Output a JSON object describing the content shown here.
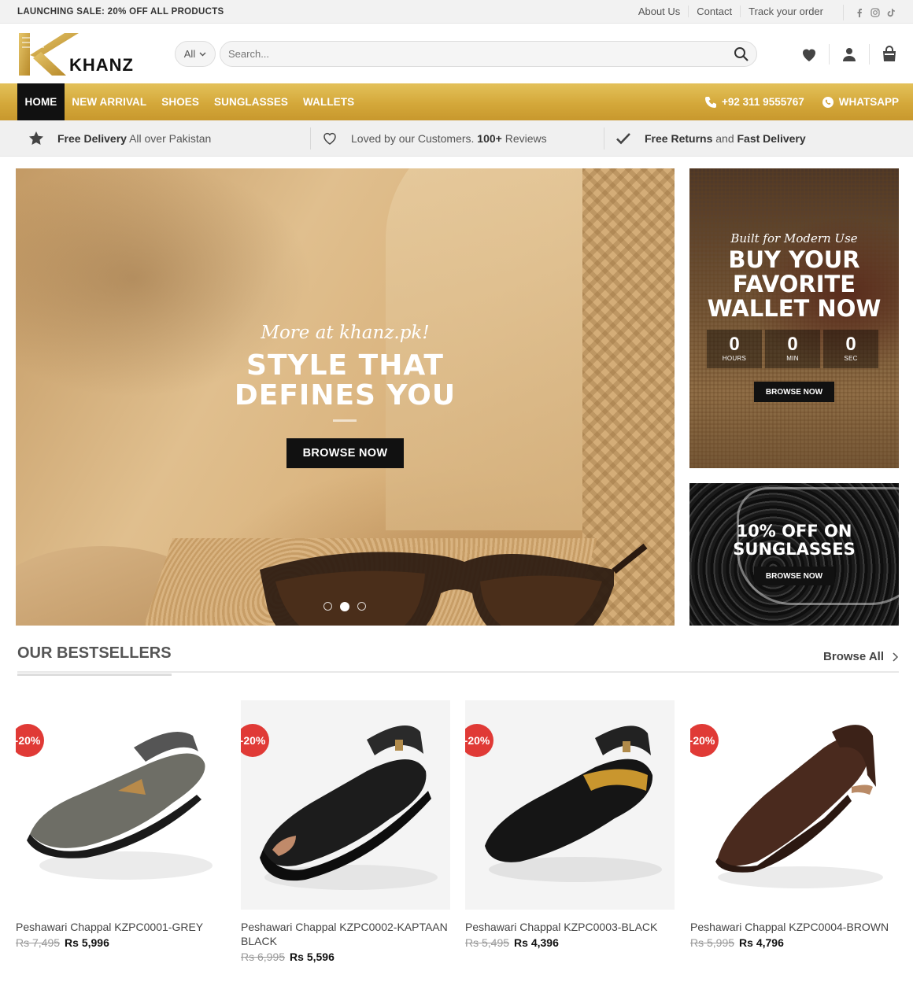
{
  "topbar": {
    "sale_text": "LAUNCHING SALE: 20% OFF ALL PRODUCTS",
    "links": [
      "About Us",
      "Contact",
      "Track your order"
    ],
    "social_icons": [
      "facebook-icon",
      "instagram-icon",
      "tiktok-icon"
    ]
  },
  "header": {
    "logo_text": "KHANZ",
    "category_select": "All",
    "search_placeholder": "Search...",
    "icons": [
      "heart-icon",
      "user-icon",
      "bag-icon"
    ]
  },
  "nav": {
    "items": [
      "HOME",
      "NEW ARRIVAL",
      "SHOES",
      "SUNGLASSES",
      "WALLETS"
    ],
    "active": "HOME",
    "phone": "+92 311 9555767",
    "whatsapp": "WHATSAPP"
  },
  "benefits": [
    {
      "bold": "Free Delivery",
      "rest": " All over Pakistan",
      "icon": "star-icon"
    },
    {
      "pre": "Loved by our Customers. ",
      "bold": "100+",
      "rest": " Reviews",
      "icon": "heart-outline-icon"
    },
    {
      "bold": "Free Returns",
      "mid": " and ",
      "bold2": "Fast Delivery",
      "icon": "check-icon"
    }
  ],
  "hero": {
    "script": "More at khanz.pk!",
    "title_line1": "STYLE THAT",
    "title_line2": "DEFINES YOU",
    "button": "BROWSE NOW",
    "slides": 3,
    "active_slide": 2
  },
  "side_banner_wallet": {
    "script": "Built for Modern Use",
    "title_line1": "BUY YOUR",
    "title_line2": "FAVORITE",
    "title_line3": "WALLET NOW",
    "countdown": [
      {
        "value": "0",
        "label": "HOURS"
      },
      {
        "value": "0",
        "label": "MIN"
      },
      {
        "value": "0",
        "label": "SEC"
      }
    ],
    "button": "BROWSE NOW"
  },
  "side_banner_sunglasses": {
    "title_line1": "10% OFF ON",
    "title_line2": "SUNGLASSES",
    "button": "BROWSE NOW"
  },
  "bestsellers": {
    "title": "OUR BESTSELLERS",
    "link": "Browse All",
    "products": [
      {
        "name": "Peshawari Chappal KZPC0001-GREY",
        "old_price": "Rs 7,495",
        "new_price": "Rs 5,996",
        "badge": "-20%",
        "color": "#6e6e66"
      },
      {
        "name": "Peshawari Chappal KZPC0002-KAPTAAN BLACK",
        "old_price": "Rs 6,995",
        "new_price": "Rs 5,596",
        "badge": "-20%",
        "color": "#1c1c1c"
      },
      {
        "name": "Peshawari Chappal KZPC0003-BLACK",
        "old_price": "Rs 5,495",
        "new_price": "Rs 4,396",
        "badge": "-20%",
        "color": "#151515"
      },
      {
        "name": "Peshawari Chappal KZPC0004-BROWN",
        "old_price": "Rs 5,995",
        "new_price": "Rs 4,796",
        "badge": "-20%",
        "color": "#4a2a1e"
      }
    ]
  }
}
